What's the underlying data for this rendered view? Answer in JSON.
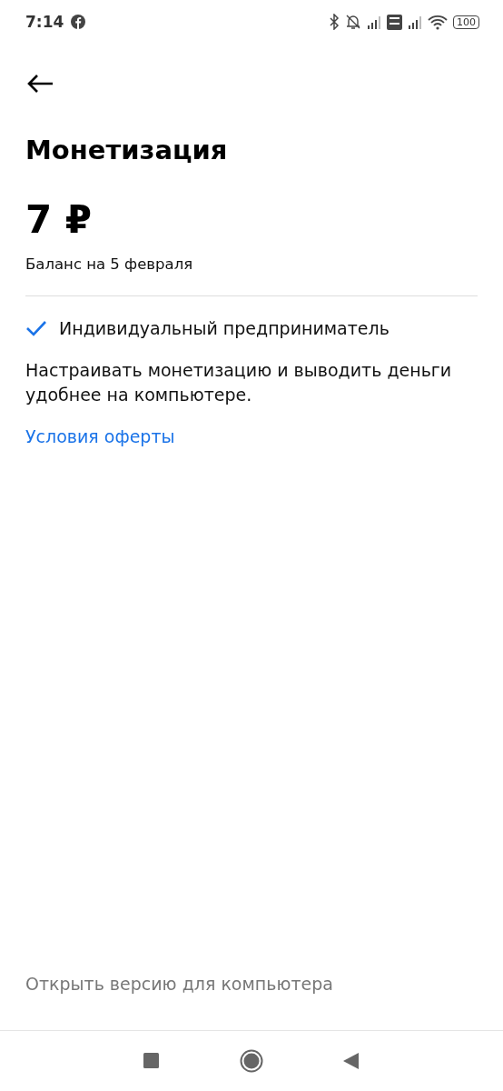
{
  "status_bar": {
    "time": "7:14",
    "battery": "100"
  },
  "title": "Монетизация",
  "balance": {
    "amount": "7 ₽",
    "caption": "Баланс на 5 февраля"
  },
  "status_item": {
    "label": "Индивидуальный предприниматель",
    "checked": true
  },
  "description": "Настраивать монетизацию и выводить деньги удобнее на компьютере.",
  "offer_link": "Условия оферты",
  "desktop_link": "Открыть версию для компьютера"
}
